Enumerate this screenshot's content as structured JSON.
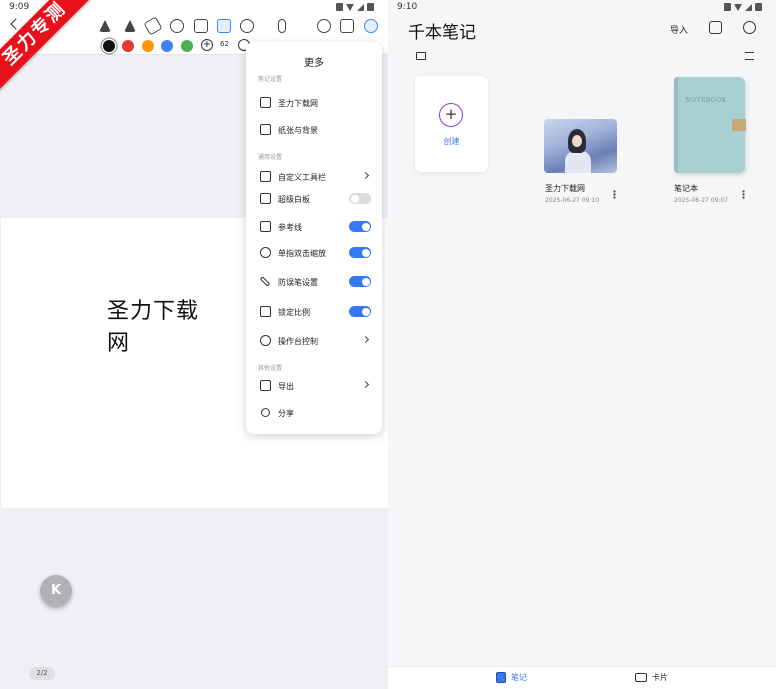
{
  "left": {
    "status_time": "9:09",
    "ribbon_text": "圣力专测",
    "toolbar_icons": [
      "back-icon",
      "pen-icon",
      "highlighter-icon",
      "eraser-icon",
      "lasso-icon",
      "image-icon",
      "shape-icon",
      "ruler-icon",
      "microphone-icon",
      "palette-icon",
      "text-icon",
      "globe-icon"
    ],
    "colors": [
      "#111111",
      "#e53935",
      "#ff9800",
      "#3b82f6",
      "#4caf50"
    ],
    "pen_size": "62",
    "canvas_text": "圣力下载网",
    "float_button": "K",
    "page_indicator": "2/2",
    "menu": {
      "title": "更多",
      "section1": "笔记设置",
      "item_rename": "圣力下载网",
      "item_paper": "纸张与背景",
      "section2": "通用设置",
      "item_toolbar": "自定义工具栏",
      "item_whiteboard": "超级白板",
      "item_guides": "参考线",
      "item_zoom": "单指双击缩放",
      "item_pen": "防误笔设置",
      "item_lock": "锁定比例",
      "item_console": "操作台控制",
      "section3": "其他设置",
      "item_export": "导出",
      "item_share": "分享",
      "toggles": {
        "whiteboard": false,
        "guides": true,
        "zoom": true,
        "pen": true,
        "lock": true
      }
    }
  },
  "right": {
    "status_time": "9:10",
    "app_title": "千本笔记",
    "import_label": "导入",
    "create_label": "创建",
    "notes": [
      {
        "name": "圣力下载网",
        "date": "2025-06-27 09:10"
      },
      {
        "name": "笔记本",
        "date": "2025-06-27 09:07",
        "cover_text": "NOTEBOOK"
      }
    ],
    "nav": {
      "notes": "笔记",
      "cards": "卡片"
    },
    "accent": "#3b7ae6"
  }
}
